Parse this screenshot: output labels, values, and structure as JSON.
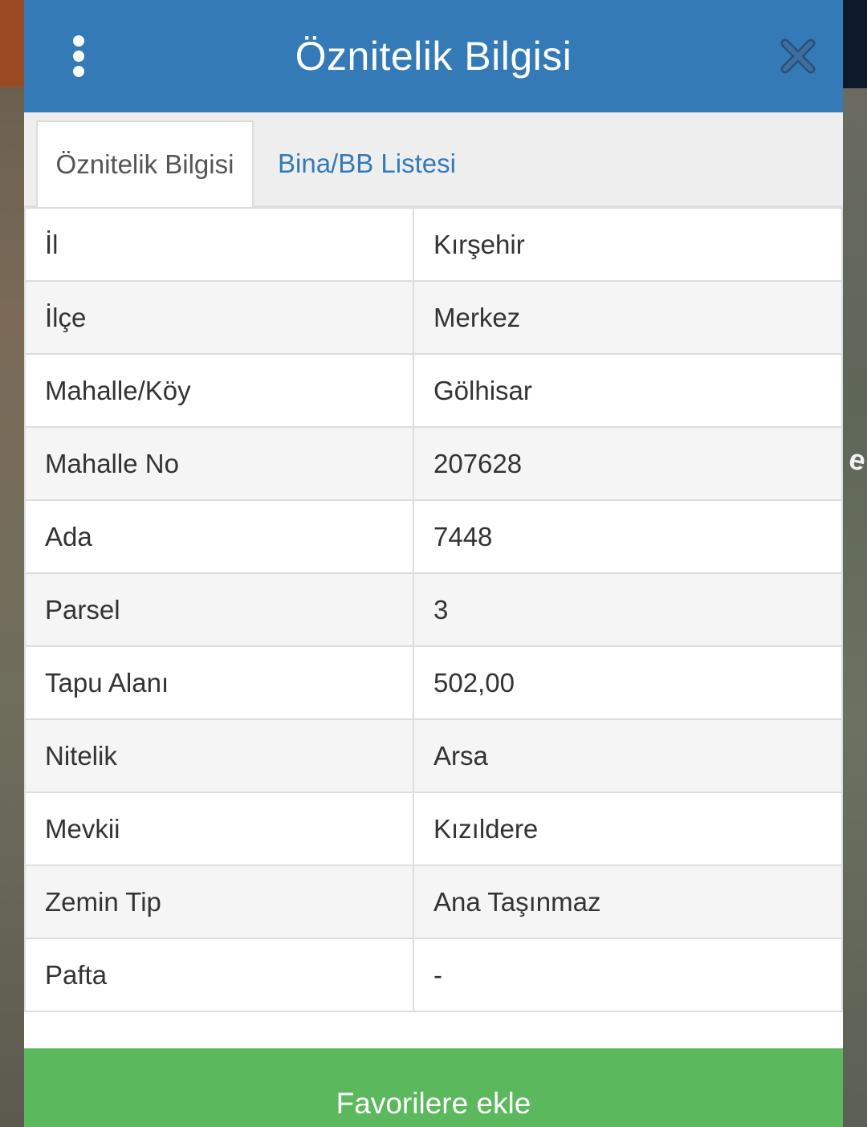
{
  "map": {
    "edge_text": "e"
  },
  "dialog": {
    "title": "Öznitelik Bilgisi",
    "menu_icon": "more-vertical-icon",
    "close_icon": "close-icon"
  },
  "tabs": [
    {
      "label": "Öznitelik Bilgisi",
      "active": true
    },
    {
      "label": "Bina/BB Listesi",
      "active": false
    }
  ],
  "attributes": [
    {
      "label": "İl",
      "value": "Kırşehir"
    },
    {
      "label": "İlçe",
      "value": "Merkez"
    },
    {
      "label": "Mahalle/Köy",
      "value": "Gölhisar"
    },
    {
      "label": "Mahalle No",
      "value": "207628"
    },
    {
      "label": "Ada",
      "value": "7448"
    },
    {
      "label": "Parsel",
      "value": "3"
    },
    {
      "label": "Tapu Alanı",
      "value": "502,00"
    },
    {
      "label": "Nitelik",
      "value": "Arsa"
    },
    {
      "label": "Mevkii",
      "value": "Kızıldere"
    },
    {
      "label": "Zemin Tip",
      "value": "Ana Taşınmaz"
    },
    {
      "label": "Pafta",
      "value": "-"
    }
  ],
  "actions": {
    "favorite_label": "Favorilere ekle"
  },
  "colors": {
    "header": "#337ab7",
    "favorite_button": "#5cb85c",
    "tab_link": "#337ab7"
  }
}
